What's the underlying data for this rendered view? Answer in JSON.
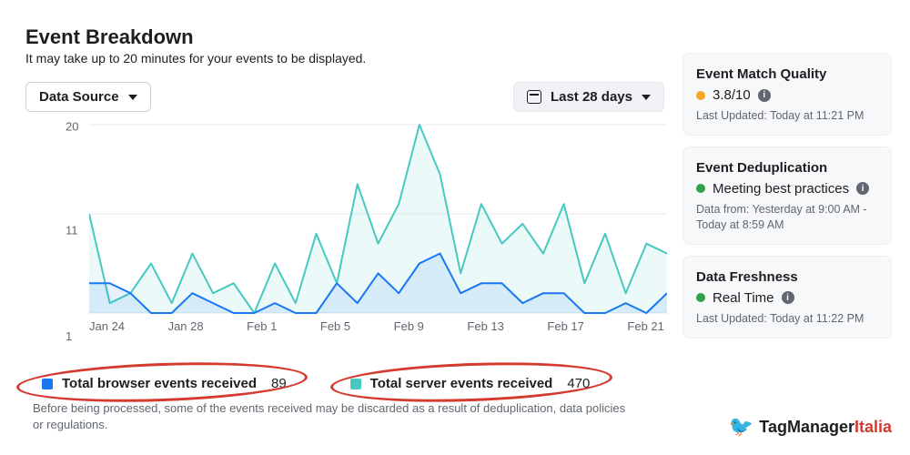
{
  "header": {
    "title": "Event Breakdown",
    "subtitle": "It may take up to 20 minutes for your events to be displayed."
  },
  "controls": {
    "data_source_label": "Data Source",
    "date_range_label": "Last 28 days"
  },
  "chart_data": {
    "type": "line",
    "ylabel": "",
    "xlabel": "",
    "ylim": [
      1,
      20
    ],
    "y_ticks": [
      1,
      11,
      20
    ],
    "x_ticks": [
      "Jan 24",
      "Jan 28",
      "Feb 1",
      "Feb 5",
      "Feb 9",
      "Feb 13",
      "Feb 17",
      "Feb 21"
    ],
    "x": [
      "Jan 24",
      "Jan 25",
      "Jan 26",
      "Jan 27",
      "Jan 28",
      "Jan 29",
      "Jan 30",
      "Jan 31",
      "Feb 1",
      "Feb 2",
      "Feb 3",
      "Feb 4",
      "Feb 5",
      "Feb 6",
      "Feb 7",
      "Feb 8",
      "Feb 9",
      "Feb 10",
      "Feb 11",
      "Feb 12",
      "Feb 13",
      "Feb 14",
      "Feb 15",
      "Feb 16",
      "Feb 17",
      "Feb 18",
      "Feb 19",
      "Feb 20",
      "Feb 21"
    ],
    "series": [
      {
        "name": "Total browser events received",
        "color": "#1877f2",
        "total": 89,
        "values": [
          4,
          4,
          3,
          1,
          1,
          3,
          2,
          1,
          1,
          2,
          1,
          1,
          4,
          2,
          5,
          3,
          6,
          7,
          3,
          4,
          4,
          2,
          3,
          3,
          1,
          1,
          2,
          1,
          3
        ]
      },
      {
        "name": "Total server events received",
        "color": "#45c9c1",
        "total": 470,
        "values": [
          11,
          2,
          3,
          6,
          2,
          7,
          3,
          4,
          1,
          6,
          2,
          9,
          4,
          14,
          8,
          12,
          20,
          15,
          5,
          12,
          8,
          10,
          7,
          12,
          4,
          9,
          3,
          8,
          7
        ]
      }
    ]
  },
  "legend": {
    "browser_label": "Total browser events received",
    "browser_value": "89",
    "server_label": "Total server events received",
    "server_value": "470"
  },
  "footnote": "Before being processed, some of the events received may be discarded as a result of deduplication, data policies or regulations.",
  "cards": {
    "match_quality": {
      "title": "Event Match Quality",
      "score": "3.8/10",
      "updated": "Last Updated: Today at 11:21 PM"
    },
    "dedup": {
      "title": "Event Deduplication",
      "status": "Meeting best practices",
      "updated": "Data from: Yesterday at 9:00 AM - Today at 8:59 AM"
    },
    "freshness": {
      "title": "Data Freshness",
      "status": "Real Time",
      "updated": "Last Updated: Today at 11:22 PM"
    }
  },
  "brand": {
    "a": "TagManager",
    "b": "Italia"
  }
}
